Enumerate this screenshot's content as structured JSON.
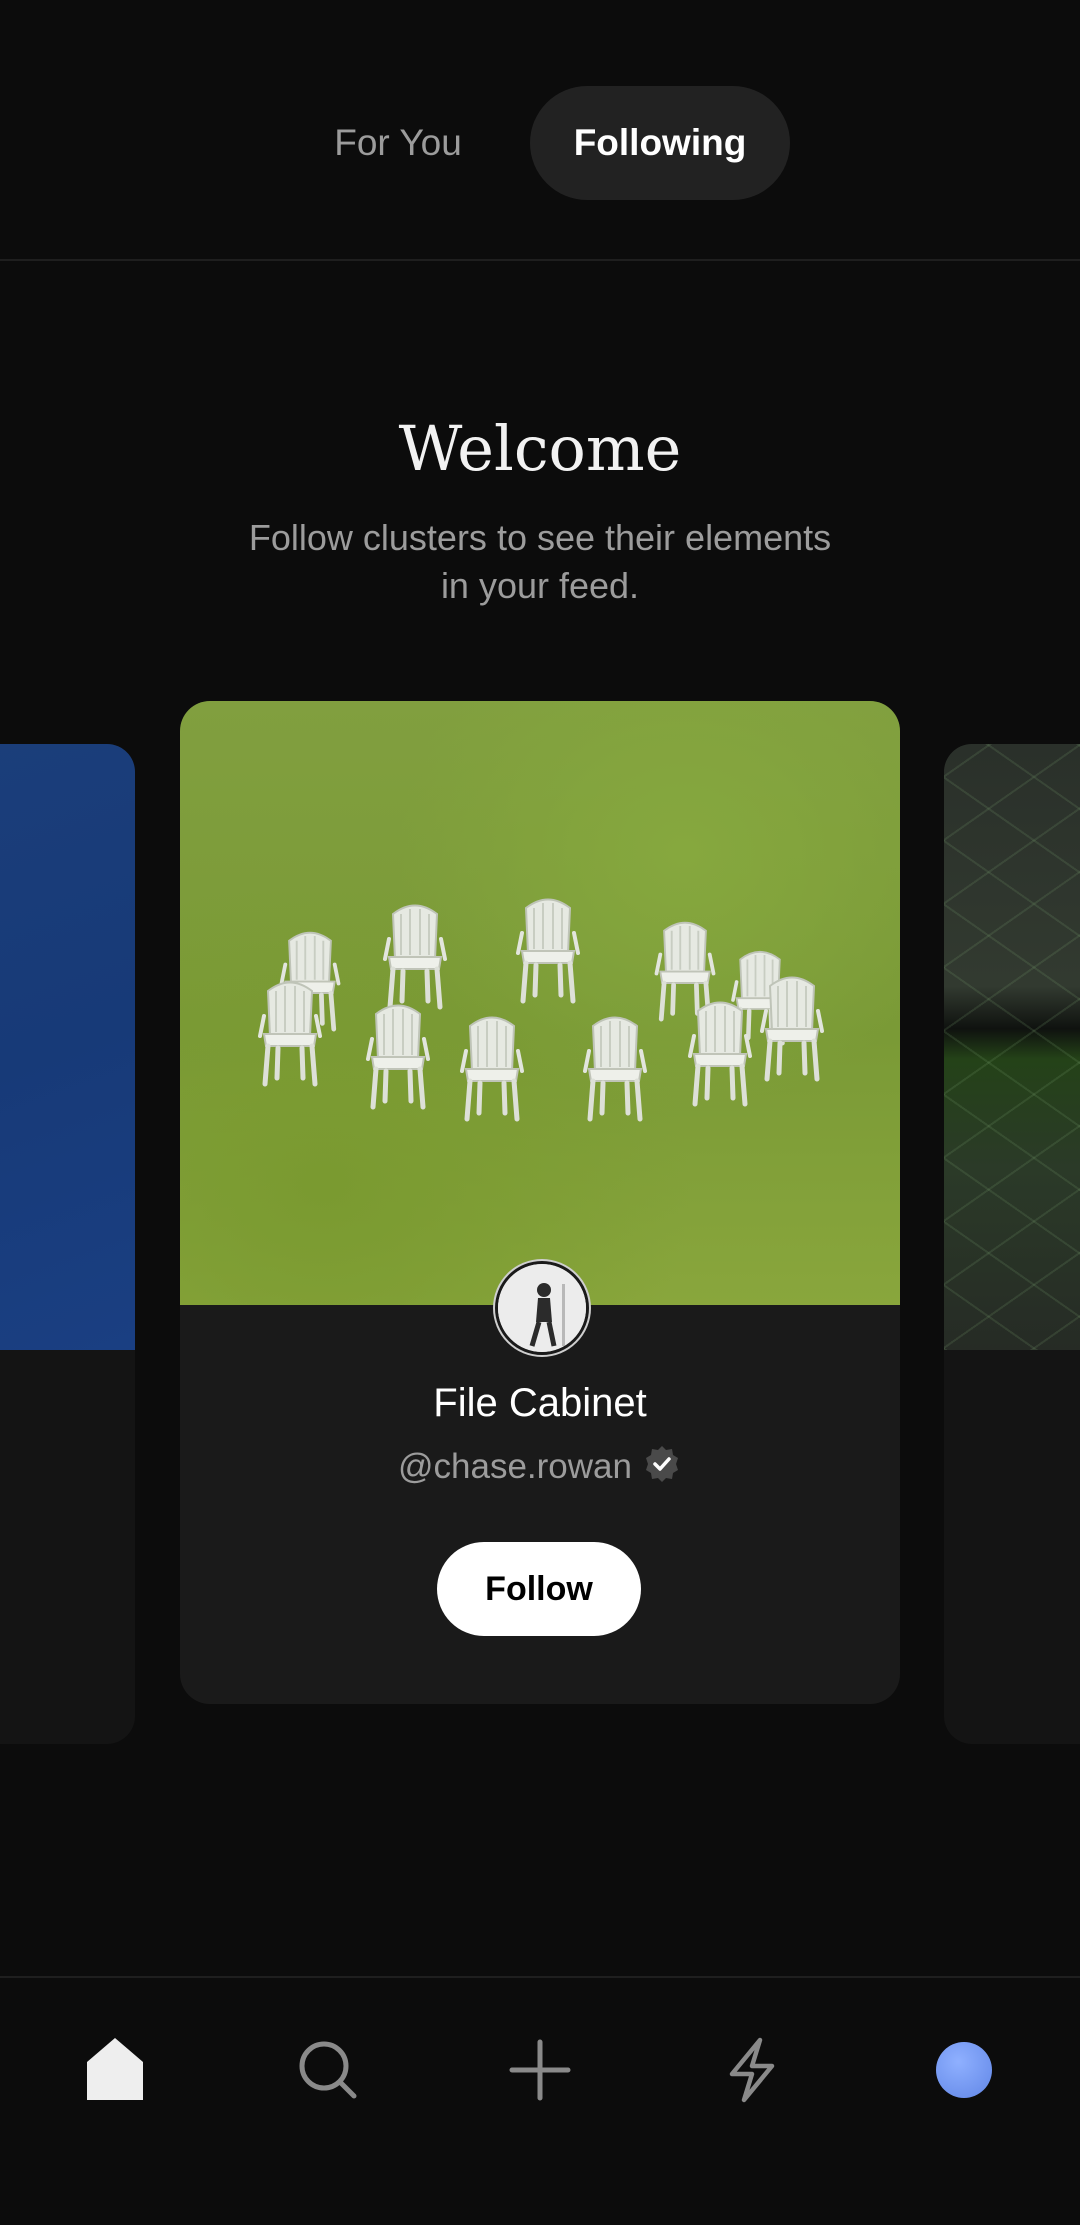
{
  "tabs": {
    "for_you": "For You",
    "following": "Following",
    "active": "Following"
  },
  "welcome": {
    "title": "Welcome",
    "subtitle": "Follow clusters to see their elements in your feed."
  },
  "featured_card": {
    "title": "File Cabinet",
    "handle": "@chase.rowan",
    "verified": true,
    "button_label": "Follow"
  },
  "bottom_nav": {
    "items": [
      {
        "icon": "home-icon",
        "active": true
      },
      {
        "icon": "search-icon",
        "active": false
      },
      {
        "icon": "plus-icon",
        "active": false
      },
      {
        "icon": "lightning-icon",
        "active": false
      },
      {
        "icon": "profile-avatar",
        "active": false
      }
    ]
  },
  "colors": {
    "background": "#0c0c0c",
    "card": "#1a1a1a",
    "muted_text": "#9c9c9c",
    "profile_accent": "#7a9cf2"
  }
}
